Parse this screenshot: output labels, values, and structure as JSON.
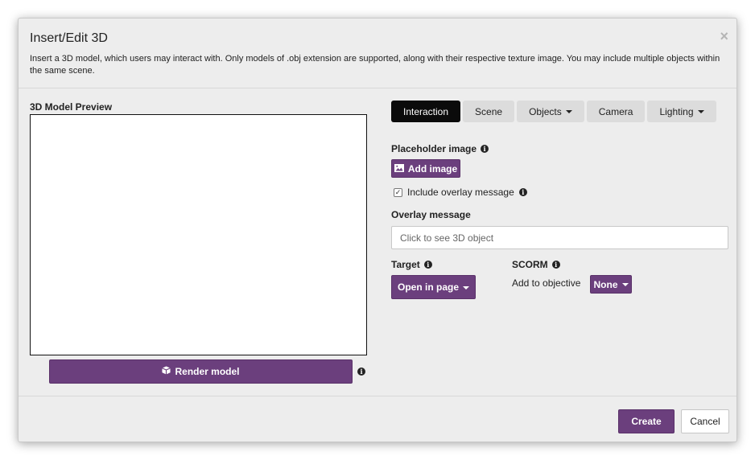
{
  "dialog": {
    "title": "Insert/Edit 3D",
    "close_glyph": "×",
    "description": "Insert a 3D model, which users may interact with. Only models of .obj extension are supported, along with their respective texture image. You may include multiple objects within the same scene."
  },
  "preview": {
    "label": "3D Model Preview",
    "render_button": "Render model",
    "render_icon": "cube-icon"
  },
  "tabs": [
    {
      "label": "Interaction",
      "active": true,
      "dropdown": false
    },
    {
      "label": "Scene",
      "active": false,
      "dropdown": false
    },
    {
      "label": "Objects",
      "active": false,
      "dropdown": true
    },
    {
      "label": "Camera",
      "active": false,
      "dropdown": false
    },
    {
      "label": "Lighting",
      "active": false,
      "dropdown": true
    }
  ],
  "interaction": {
    "placeholder_label": "Placeholder image",
    "add_image_button": "Add image",
    "include_overlay_label": "Include overlay message",
    "include_overlay_checked": true,
    "overlay_label": "Overlay message",
    "overlay_placeholder": "Click to see 3D object",
    "target_label": "Target",
    "target_value": "Open in page",
    "scorm_label": "SCORM",
    "objective_label": "Add to objective",
    "objective_value": "None"
  },
  "footer": {
    "create_button": "Create",
    "cancel_button": "Cancel"
  },
  "colors": {
    "accent": "#6b3f7d",
    "active_tab": "#0b0b0b",
    "dialog_bg": "#ededed"
  },
  "info_glyph": "i"
}
